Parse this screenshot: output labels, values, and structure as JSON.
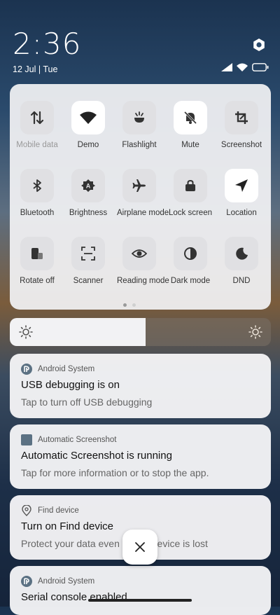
{
  "status": {
    "time": "2:36",
    "date": "12 Jul | Tue"
  },
  "tiles": [
    {
      "label": "Mobile data",
      "icon": "mobile-data-icon",
      "on": false,
      "dim": true
    },
    {
      "label": "Demo",
      "icon": "wifi-icon",
      "on": true,
      "dim": false
    },
    {
      "label": "Flashlight",
      "icon": "flashlight-icon",
      "on": false,
      "dim": false
    },
    {
      "label": "Mute",
      "icon": "mute-bell-icon",
      "on": true,
      "dim": false
    },
    {
      "label": "Screenshot",
      "icon": "screenshot-crop-icon",
      "on": false,
      "dim": false
    },
    {
      "label": "Bluetooth",
      "icon": "bluetooth-icon",
      "on": false,
      "dim": false
    },
    {
      "label": "Brightness",
      "icon": "auto-brightness-icon",
      "on": false,
      "dim": false
    },
    {
      "label": "Airplane mode",
      "icon": "airplane-icon",
      "on": false,
      "dim": false
    },
    {
      "label": "Lock screen",
      "icon": "lock-screen-icon",
      "on": false,
      "dim": false
    },
    {
      "label": "Location",
      "icon": "location-icon",
      "on": true,
      "dim": false
    },
    {
      "label": "Rotate off",
      "icon": "rotate-icon",
      "on": false,
      "dim": false
    },
    {
      "label": "Scanner",
      "icon": "scanner-icon",
      "on": false,
      "dim": false
    },
    {
      "label": "Reading mode",
      "icon": "eye-icon",
      "on": false,
      "dim": false
    },
    {
      "label": "Dark mode",
      "icon": "dark-mode-icon",
      "on": false,
      "dim": false
    },
    {
      "label": "DND",
      "icon": "moon-icon",
      "on": false,
      "dim": false
    }
  ],
  "brightness": {
    "level": 0.52
  },
  "notifications": [
    {
      "app": "Android System",
      "title": "USB debugging is on",
      "body": "Tap to turn off USB debugging"
    },
    {
      "app": "Automatic Screenshot",
      "title": "Automatic Screenshot is running",
      "body": "Tap for more information or to stop the app."
    },
    {
      "app": "Find device",
      "title": "Turn on Find device",
      "body": "Protect your data even if your device is lost"
    },
    {
      "app": "Android System",
      "title": "Serial console enabled",
      "body": ""
    }
  ]
}
